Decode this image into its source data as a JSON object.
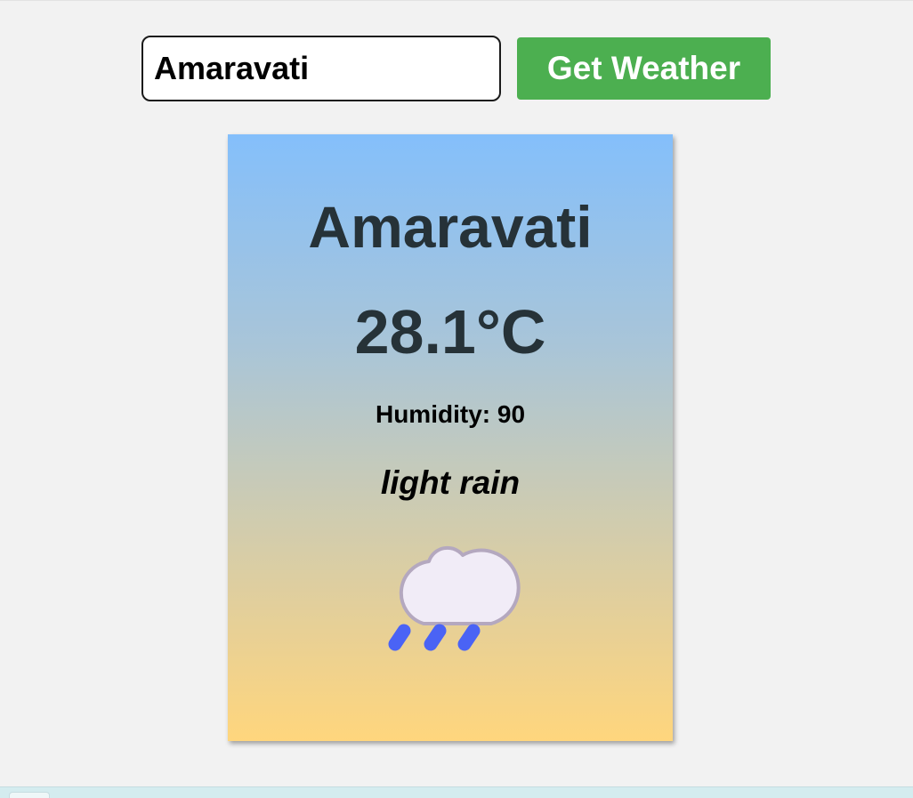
{
  "search": {
    "value": "Amaravati"
  },
  "actions": {
    "get_weather_label": "Get Weather"
  },
  "weather": {
    "city": "Amaravati",
    "temperature": "28.1°C",
    "humidity": "Humidity: 90",
    "description": "light rain",
    "icon": "rain-cloud-icon"
  },
  "colors": {
    "button": "#4caf50",
    "card_top": "#84bffb",
    "card_bottom": "#ffd67d",
    "heading_text": "#263238",
    "raindrop": "#4a63f5"
  }
}
